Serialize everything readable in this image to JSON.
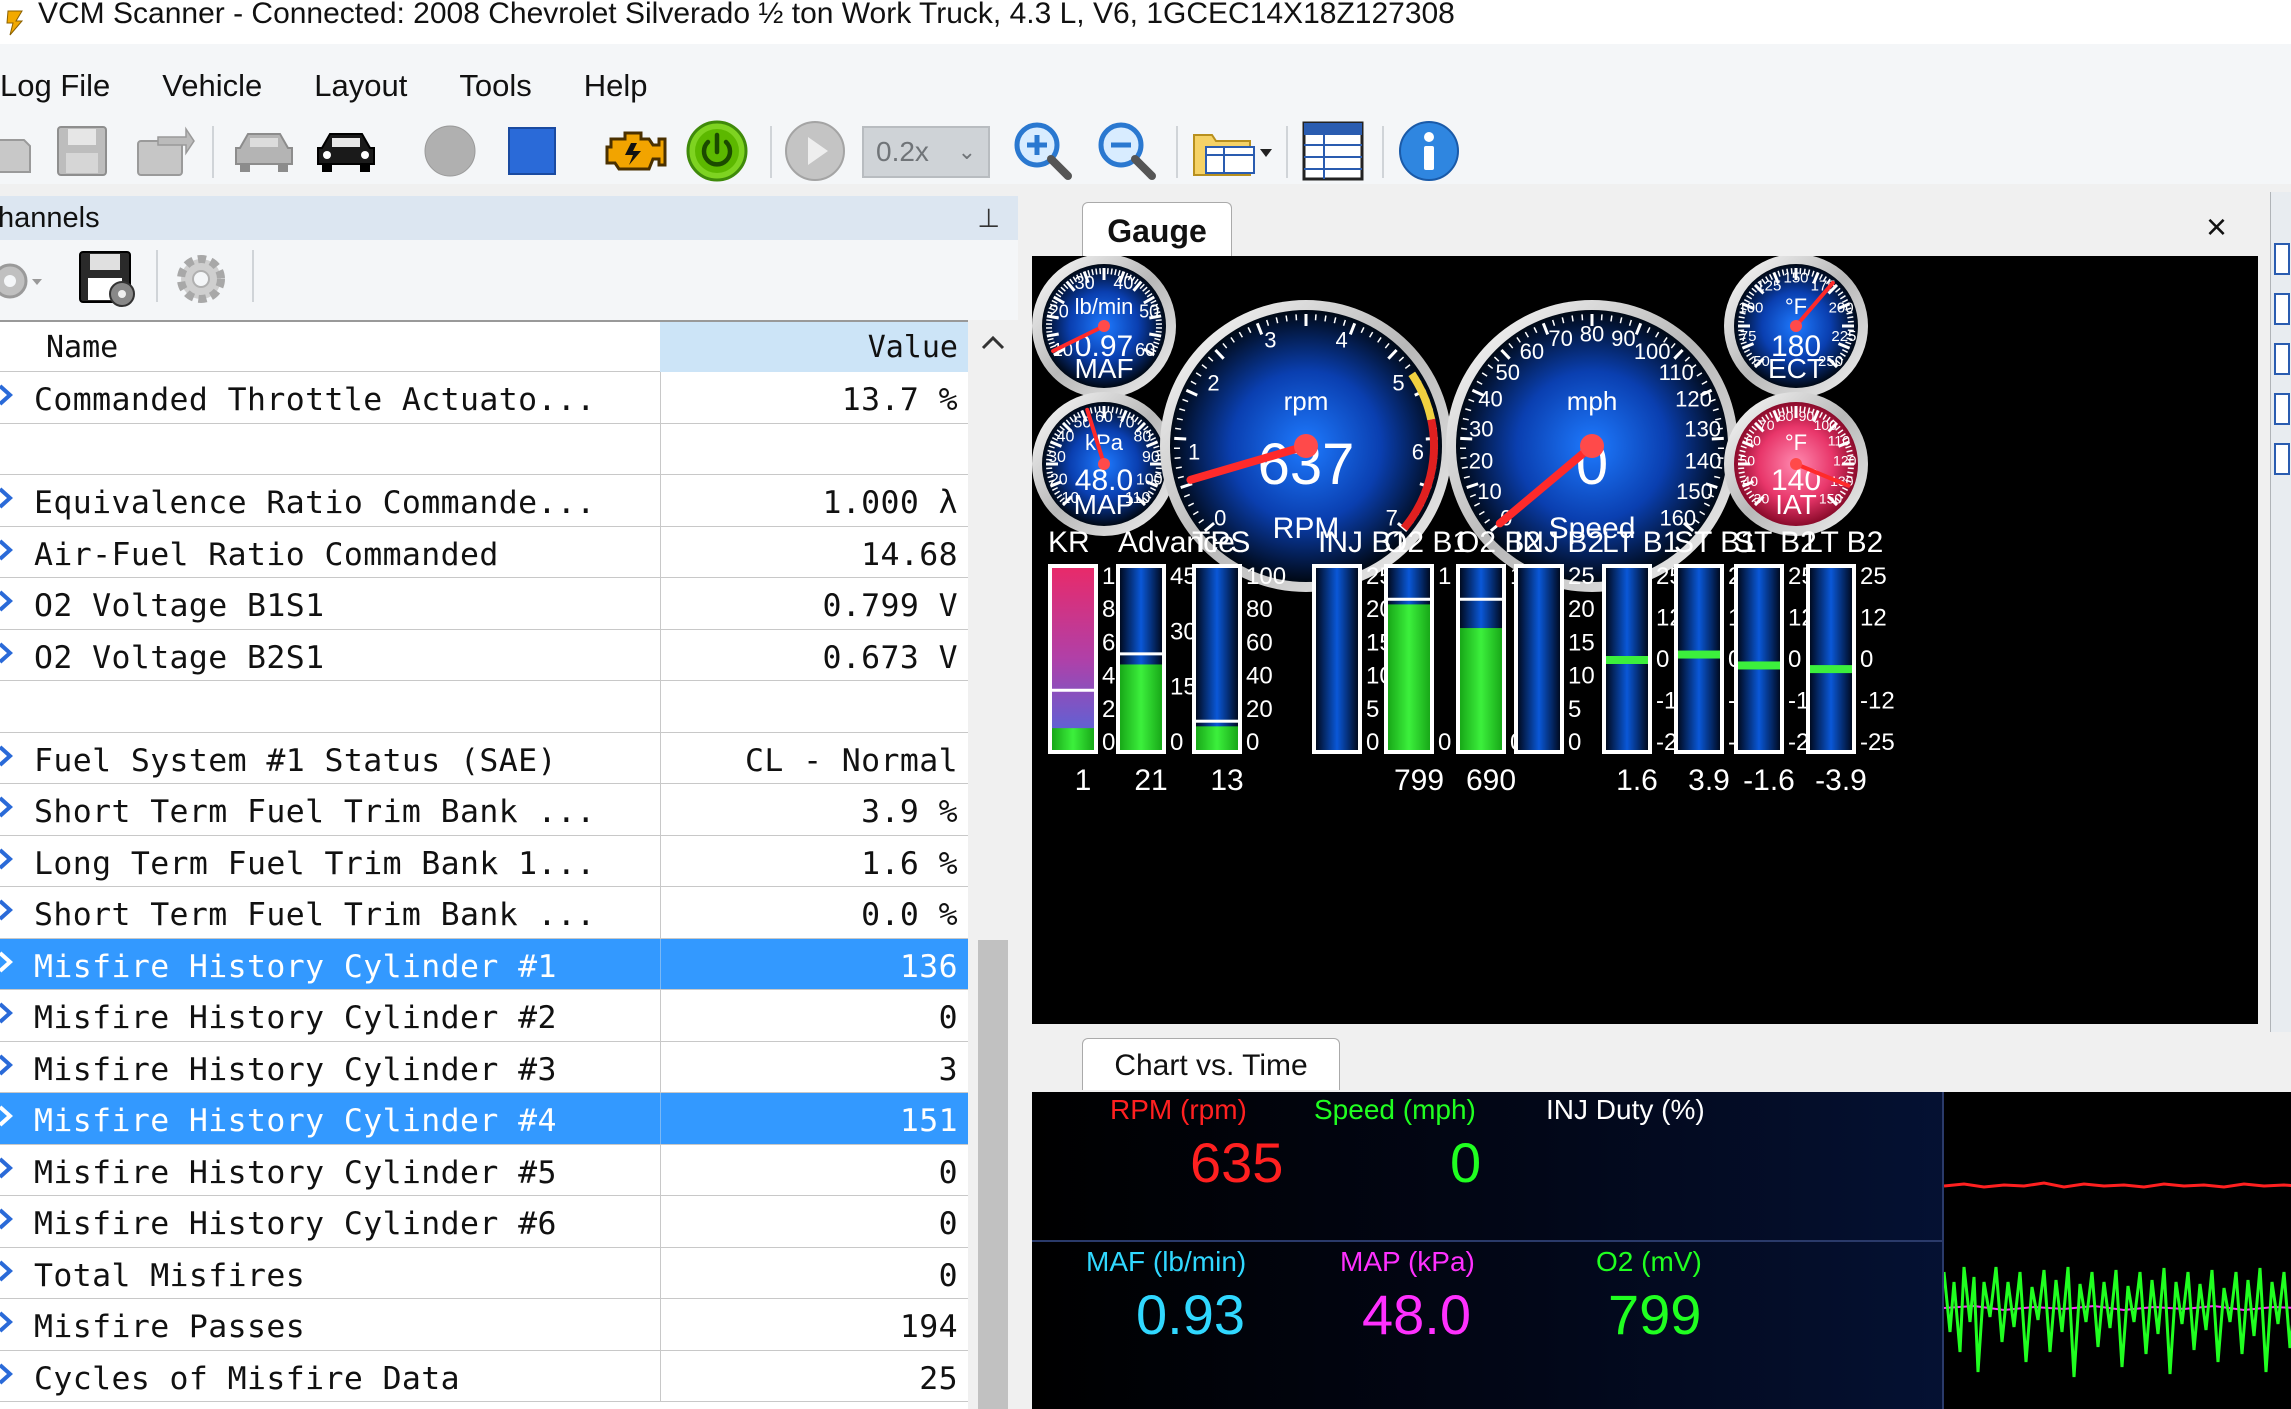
{
  "window": {
    "title": "VCM Scanner - Connected: 2008 Chevrolet Silverado ½ ton Work Truck, 4.3 L, V6, 1GCEC14X18Z127308"
  },
  "menu": [
    "Log File",
    "Vehicle",
    "Layout",
    "Tools",
    "Help"
  ],
  "toolbar": {
    "speed_value": "0.2x",
    "icons": [
      "open-log-icon",
      "save-log-icon",
      "export-log-icon",
      "vehicle-disconnected-icon",
      "vehicle-connected-icon",
      "record-icon",
      "stop-icon",
      "engine-icon",
      "power-icon",
      "play-icon",
      "zoom-in-icon",
      "zoom-out-icon",
      "layout-icon",
      "table-icon",
      "info-icon"
    ]
  },
  "channels": {
    "title": "hannels",
    "columns": {
      "name": "Name",
      "value": "Value"
    },
    "rows": [
      {
        "name": "Commanded Throttle Actuato...",
        "value": "13.7 %",
        "selected": false,
        "arrow": true
      },
      {
        "name": "",
        "value": "",
        "selected": false,
        "arrow": false
      },
      {
        "name": "Equivalence Ratio Commande...",
        "value": "1.000 λ",
        "selected": false,
        "arrow": true
      },
      {
        "name": "Air-Fuel Ratio Commanded",
        "value": "14.68",
        "selected": false,
        "arrow": true
      },
      {
        "name": "O2 Voltage B1S1",
        "value": "0.799 V",
        "selected": false,
        "arrow": true
      },
      {
        "name": "O2 Voltage B2S1",
        "value": "0.673 V",
        "selected": false,
        "arrow": true
      },
      {
        "name": "",
        "value": "",
        "selected": false,
        "arrow": false
      },
      {
        "name": "Fuel System #1 Status (SAE)",
        "value": "CL - Normal",
        "selected": false,
        "arrow": true
      },
      {
        "name": "Short Term Fuel Trim Bank ...",
        "value": "3.9 %",
        "selected": false,
        "arrow": true
      },
      {
        "name": "Long Term Fuel Trim Bank 1...",
        "value": "1.6 %",
        "selected": false,
        "arrow": true
      },
      {
        "name": "Short Term Fuel Trim Bank ...",
        "value": "0.0 %",
        "selected": false,
        "arrow": true
      },
      {
        "name": "Misfire History Cylinder #1",
        "value": "136",
        "selected": true,
        "arrow": true
      },
      {
        "name": "Misfire History Cylinder #2",
        "value": "0",
        "selected": false,
        "arrow": true
      },
      {
        "name": "Misfire History Cylinder #3",
        "value": "3",
        "selected": false,
        "arrow": true
      },
      {
        "name": "Misfire History Cylinder #4",
        "value": "151",
        "selected": true,
        "arrow": true
      },
      {
        "name": "Misfire History Cylinder #5",
        "value": "0",
        "selected": false,
        "arrow": true
      },
      {
        "name": "Misfire History Cylinder #6",
        "value": "0",
        "selected": false,
        "arrow": true
      },
      {
        "name": "Total Misfires",
        "value": "0",
        "selected": false,
        "arrow": true
      },
      {
        "name": "Misfire Passes",
        "value": "194",
        "selected": false,
        "arrow": true
      },
      {
        "name": "Cycles of Misfire Data",
        "value": "25",
        "selected": false,
        "arrow": true
      }
    ]
  },
  "gauge_panel": {
    "tab": "Gauge",
    "close": "×",
    "gauges": {
      "maf": {
        "label": "MAF",
        "unit": "lb/min",
        "value": "0.97",
        "ticks": [
          "10",
          "20",
          "30",
          "40",
          "50",
          "60"
        ],
        "level": 0.97,
        "min": 0,
        "max": 60
      },
      "map": {
        "label": "MAP",
        "unit": "kPa",
        "value": "48.0",
        "ticks": [
          "10",
          "20",
          "30",
          "40",
          "50",
          "60",
          "70",
          "80",
          "90",
          "100",
          "110"
        ],
        "level": 48.0,
        "min": 0,
        "max": 110
      },
      "rpm": {
        "label": "RPM",
        "unit": "rpm",
        "value": "637",
        "ticks": [
          "0",
          "1",
          "2",
          "3",
          "4",
          "5",
          "6",
          "7"
        ],
        "level": 0.637,
        "min": 0,
        "max": 7
      },
      "speed": {
        "label": "Speed",
        "unit": "mph",
        "value": "0",
        "ticks": [
          "0",
          "10",
          "20",
          "30",
          "40",
          "50",
          "60",
          "70",
          "80",
          "90",
          "100",
          "110",
          "120",
          "130",
          "140",
          "150",
          "160"
        ],
        "level": 0,
        "min": 0,
        "max": 160
      },
      "ect": {
        "label": "ECT",
        "unit": "°F",
        "value": "180",
        "ticks": [
          "50",
          "75",
          "100",
          "125",
          "150",
          "175",
          "200",
          "225",
          "250"
        ],
        "level": 180,
        "min": 50,
        "max": 250
      },
      "iat": {
        "label": "IAT",
        "unit": "°F",
        "value": "140",
        "ticks": [
          "30",
          "40",
          "50",
          "60",
          "70",
          "80",
          "90",
          "100",
          "110",
          "120",
          "130",
          "150"
        ],
        "level": 140,
        "min": 30,
        "max": 150
      }
    },
    "bars": [
      {
        "label": "KR",
        "value": "1",
        "scale": [
          "10",
          "8",
          "6",
          "4",
          "2",
          "0"
        ],
        "fill": 0.12,
        "marker": 0.32,
        "style": "kr"
      },
      {
        "label": "Advance",
        "value": "21",
        "scale": [
          "45",
          "30",
          "15",
          "0"
        ],
        "fill": 0.47,
        "marker": 0.52,
        "style": "green"
      },
      {
        "label": "TPS",
        "value": "13",
        "scale": [
          "100",
          "80",
          "60",
          "40",
          "20",
          "0"
        ],
        "fill": 0.13,
        "marker": 0.15,
        "style": "green"
      },
      {
        "label": "INJ B1",
        "value": "",
        "scale": [
          "25",
          "20",
          "15",
          "10",
          "5",
          "0"
        ],
        "fill": 0.0,
        "marker": null,
        "style": "blue"
      },
      {
        "label": "O2 B1",
        "value": "799",
        "scale": [
          "1",
          "0"
        ],
        "fill": 0.8,
        "marker": 0.82,
        "style": "green"
      },
      {
        "label": "O2 B2",
        "value": "690",
        "scale": [
          "1",
          "0"
        ],
        "fill": 0.67,
        "marker": 0.82,
        "style": "green"
      },
      {
        "label": "INJ B2",
        "value": "",
        "scale": [
          "25",
          "20",
          "15",
          "10",
          "5",
          "0"
        ],
        "fill": 0.0,
        "marker": null,
        "style": "blue"
      },
      {
        "label": "LT B1",
        "value": "1.6",
        "scale": [
          "25",
          "12",
          "0",
          "-12",
          "-25"
        ],
        "fill": 0.0,
        "marker": 0.5,
        "style": "trim"
      },
      {
        "label": "ST B1",
        "value": "3.9",
        "scale": [
          "25",
          "12",
          "0",
          "-12",
          "-25"
        ],
        "fill": 0.0,
        "marker": 0.53,
        "style": "trim"
      },
      {
        "label": "ST B2",
        "value": "-1.6",
        "scale": [
          "25",
          "12",
          "0",
          "-12",
          "-25"
        ],
        "fill": 0.0,
        "marker": 0.47,
        "style": "trim"
      },
      {
        "label": "LT B2",
        "value": "-3.9",
        "scale": [
          "25",
          "12",
          "0",
          "-12",
          "-25"
        ],
        "fill": 0.0,
        "marker": 0.45,
        "style": "trim"
      }
    ]
  },
  "chart_panel": {
    "tab": "Chart vs. Time",
    "readouts": [
      {
        "label": "RPM (rpm)",
        "value": "635",
        "color": "#ff2020"
      },
      {
        "label": "Speed (mph)",
        "value": "0",
        "color": "#20ff20"
      },
      {
        "label": "INJ Duty (%)",
        "value": "",
        "color": "#ffffff"
      },
      {
        "label": "MAF (lb/min)",
        "value": "0.93",
        "color": "#30d8ff"
      },
      {
        "label": "MAP (kPa)",
        "value": "48.0",
        "color": "#ff30ff"
      },
      {
        "label": "O2 (mV)",
        "value": "799",
        "color": "#20ff20"
      }
    ]
  },
  "colors": {
    "selection": "#3399ff",
    "gauge_bg": "#000000",
    "needle": "#ff2a2a",
    "bar_green": "#22cc22"
  }
}
